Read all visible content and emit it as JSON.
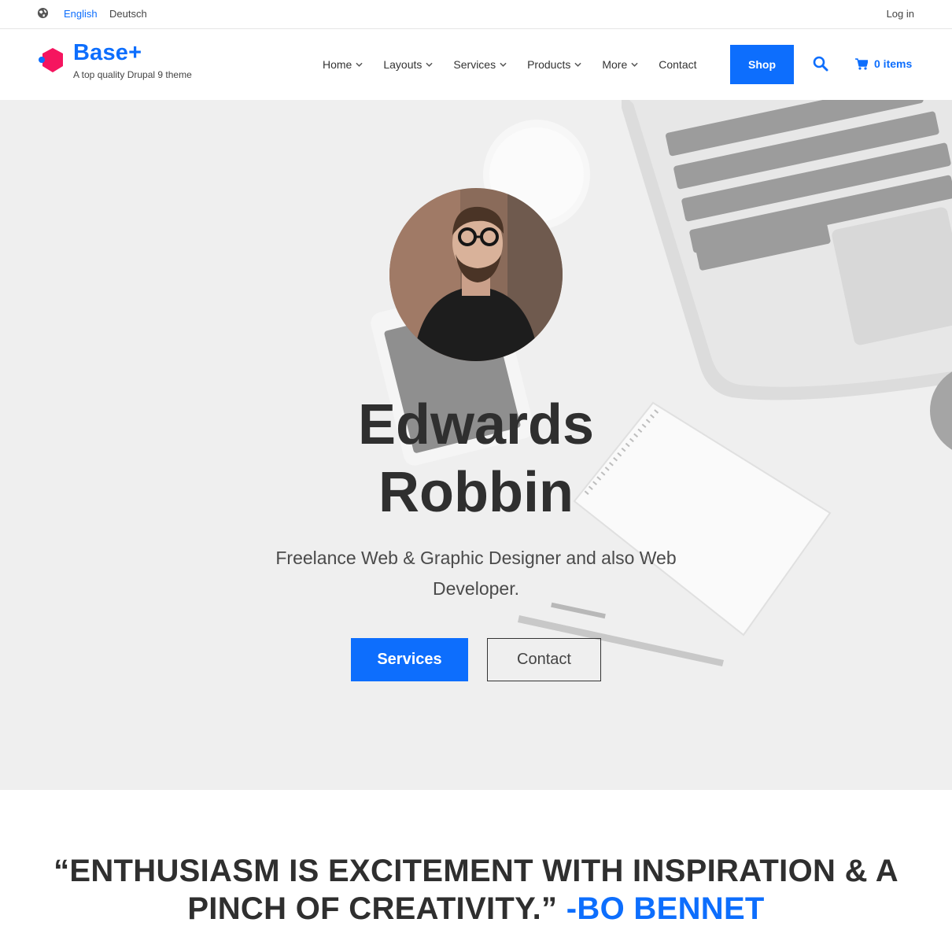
{
  "topbar": {
    "globe_icon": "globe-icon",
    "languages": [
      "English",
      "Deutsch"
    ],
    "active_language": "English",
    "login": "Log in"
  },
  "header": {
    "logo_icon": "hexagon-logo-icon",
    "site_name": "Base+",
    "slogan": "A top quality Drupal 9 theme",
    "nav": [
      {
        "label": "Home",
        "dropdown": true
      },
      {
        "label": "Layouts",
        "dropdown": true
      },
      {
        "label": "Services",
        "dropdown": true
      },
      {
        "label": "Products",
        "dropdown": true
      },
      {
        "label": "More",
        "dropdown": true
      },
      {
        "label": "Contact",
        "dropdown": false
      }
    ],
    "shop_label": "Shop",
    "search_icon": "search-icon",
    "cart_icon": "cart-icon",
    "cart_label": "0 items"
  },
  "hero": {
    "name_line1": "Edwards",
    "name_line2": "Robbin",
    "subtitle": "Freelance Web & Graphic Designer and also Web Developer.",
    "primary_button": "Services",
    "secondary_button": "Contact"
  },
  "quote": {
    "text": "“ENTHUSIASM IS EXCITEMENT WITH INSPIRATION & A PINCH OF CREATIVITY.”",
    "author": "-BO BENNET"
  },
  "colors": {
    "accent": "#0d6efd",
    "logo_pink": "#f5155f",
    "text_dark": "#2f2f2f",
    "hero_bg": "#efefef"
  }
}
